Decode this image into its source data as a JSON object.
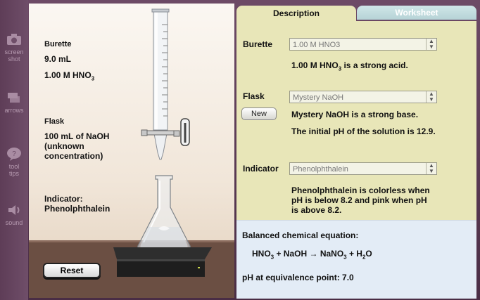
{
  "sidebar": {
    "screenshot_label_1": "screen",
    "screenshot_label_2": "shot",
    "arrows_label": "arrows",
    "tooltips_label_1": "tool",
    "tooltips_label_2": "tips",
    "sound_label": "sound"
  },
  "sim": {
    "burette_title": "Burette",
    "burette_volume": "9.0 mL",
    "burette_solution_main": "1.00 M HNO",
    "burette_solution_sub": "3",
    "flask_title": "Flask",
    "flask_line1": "100 mL of NaOH",
    "flask_line2": "(unknown",
    "flask_line3": "concentration)",
    "indicator_line1": "Indicator:",
    "indicator_line2": "Phenolphthalein",
    "reset_label": "Reset"
  },
  "tabs": {
    "description": "Description",
    "worksheet": "Worksheet"
  },
  "description": {
    "burette_label": "Burette",
    "burette_select": "1.00 M HNO3",
    "burette_info_pre": "1.00 M HNO",
    "burette_info_sub": "3",
    "burette_info_post": " is a strong acid.",
    "flask_label": "Flask",
    "flask_select": "Mystery NaOH",
    "new_button": "New",
    "flask_info1": "Mystery NaOH is a strong base.",
    "flask_info2": "The initial pH of the solution is 12.9.",
    "indicator_label": "Indicator",
    "indicator_select": "Phenolphthalein",
    "indicator_info1": "Phenolphthalein is colorless when",
    "indicator_info2": "pH is below 8.2 and pink when pH",
    "indicator_info3": "is above 8.2."
  },
  "equation": {
    "title": "Balanced chemical equation:",
    "r1": "HNO",
    "r1_sub": "3",
    "plus1": " + NaOH ",
    "arrow": "→",
    "p1": " NaNO",
    "p1_sub": "3",
    "plus2": " + H",
    "p2_sub": "2",
    "p2_post": "O",
    "ph_equivalence": "pH at equivalence point: 7.0"
  }
}
